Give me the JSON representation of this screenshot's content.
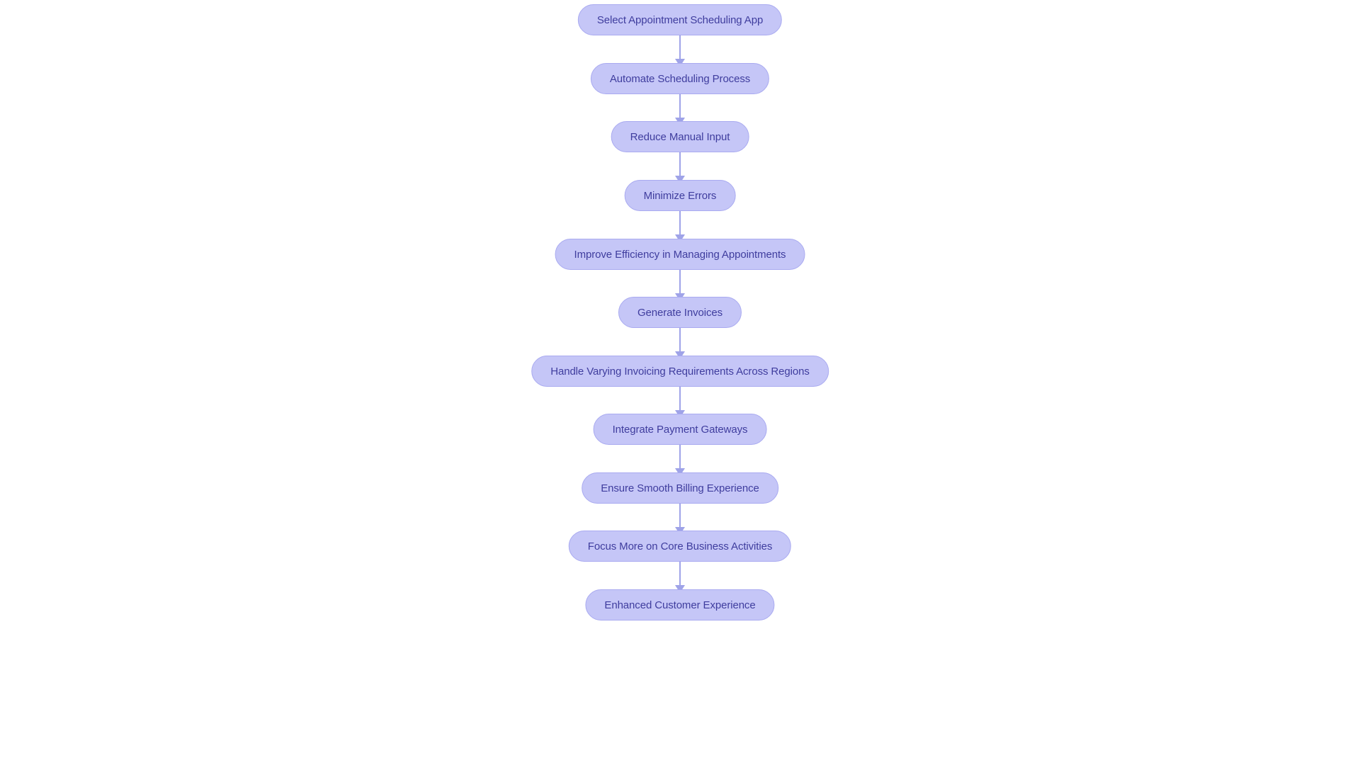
{
  "diagram": {
    "type": "flowchart",
    "orientation": "top-to-bottom",
    "title": "",
    "node_shape": "stadium",
    "colors": {
      "node_fill": "#c5c6f7",
      "node_border": "#a9aaf0",
      "node_text": "#3f3d9e",
      "arrow": "#9fa3e8",
      "background": "#ffffff"
    },
    "nodes": [
      {
        "id": "n1",
        "label": "Select Appointment Scheduling App"
      },
      {
        "id": "n2",
        "label": "Automate Scheduling Process"
      },
      {
        "id": "n3",
        "label": "Reduce Manual Input"
      },
      {
        "id": "n4",
        "label": "Minimize Errors"
      },
      {
        "id": "n5",
        "label": "Improve Efficiency in Managing Appointments"
      },
      {
        "id": "n6",
        "label": "Generate Invoices"
      },
      {
        "id": "n7",
        "label": "Handle Varying Invoicing Requirements Across Regions"
      },
      {
        "id": "n8",
        "label": "Integrate Payment Gateways"
      },
      {
        "id": "n9",
        "label": "Ensure Smooth Billing Experience"
      },
      {
        "id": "n10",
        "label": "Focus More on Core Business Activities"
      },
      {
        "id": "n11",
        "label": "Enhanced Customer Experience"
      }
    ],
    "edges": [
      {
        "from": "n1",
        "to": "n2",
        "label": ""
      },
      {
        "from": "n2",
        "to": "n3",
        "label": ""
      },
      {
        "from": "n3",
        "to": "n4",
        "label": ""
      },
      {
        "from": "n4",
        "to": "n5",
        "label": ""
      },
      {
        "from": "n5",
        "to": "n6",
        "label": ""
      },
      {
        "from": "n6",
        "to": "n7",
        "label": ""
      },
      {
        "from": "n7",
        "to": "n8",
        "label": ""
      },
      {
        "from": "n8",
        "to": "n9",
        "label": ""
      },
      {
        "from": "n9",
        "to": "n10",
        "label": ""
      },
      {
        "from": "n10",
        "to": "n11",
        "label": ""
      }
    ]
  }
}
